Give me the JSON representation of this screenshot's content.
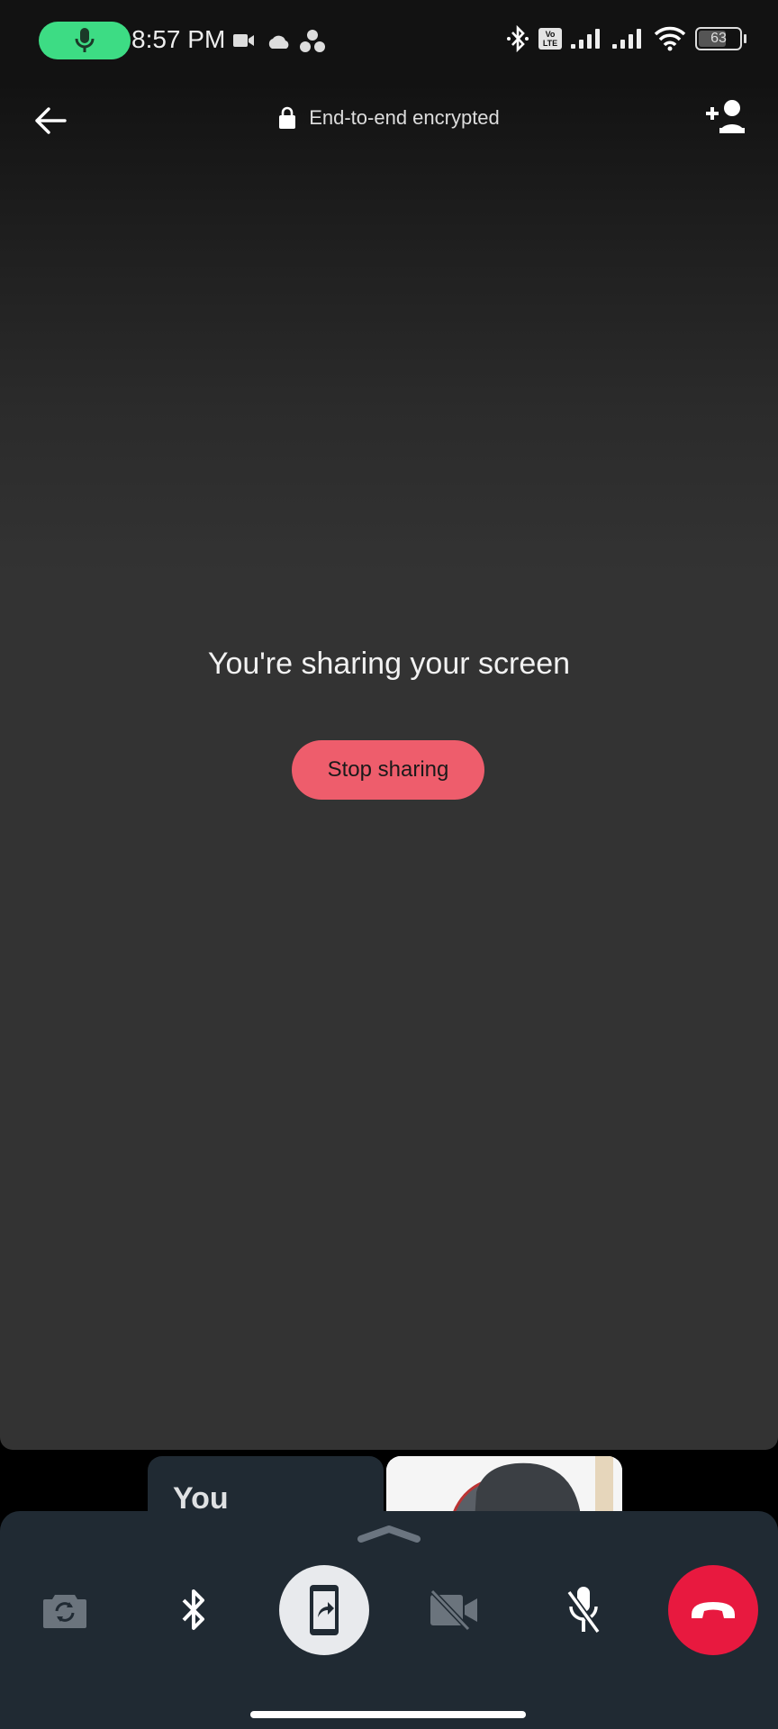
{
  "status_bar": {
    "time": "8:57 PM",
    "battery_level": "63",
    "battery_percent": 63,
    "left_icons": [
      "mic-active-icon",
      "video-icon",
      "cloud-icon",
      "dots-cluster-icon"
    ],
    "right_icons": [
      "bluetooth-icon",
      "volte-icon",
      "signal-icon",
      "signal-icon",
      "wifi-icon",
      "battery-icon"
    ],
    "volte_label_top": "Vo",
    "volte_label_bottom": "LTE",
    "accent_color": "#3ddc84"
  },
  "header": {
    "encryption_label": "End-to-end encrypted",
    "back_icon": "arrow-left-icon",
    "add_participant_icon": "person-add-icon"
  },
  "main": {
    "sharing_message": "You're sharing your screen",
    "stop_sharing_label": "Stop sharing",
    "stop_button_color": "#ee5d6c"
  },
  "participants": [
    {
      "label": "You",
      "type": "self"
    },
    {
      "label": "",
      "type": "remote-video"
    }
  ],
  "controls": {
    "items": [
      {
        "name": "flip-camera",
        "icon": "camera-flip-icon",
        "state": "disabled"
      },
      {
        "name": "bluetooth-audio",
        "icon": "bluetooth-icon",
        "state": "enabled"
      },
      {
        "name": "screen-share",
        "icon": "screen-share-icon",
        "state": "active"
      },
      {
        "name": "video-toggle",
        "icon": "video-off-icon",
        "state": "off"
      },
      {
        "name": "mic-toggle",
        "icon": "mic-off-icon",
        "state": "muted"
      },
      {
        "name": "end-call",
        "icon": "call-end-icon",
        "state": "enabled"
      }
    ],
    "end_call_color": "#e8193f"
  }
}
